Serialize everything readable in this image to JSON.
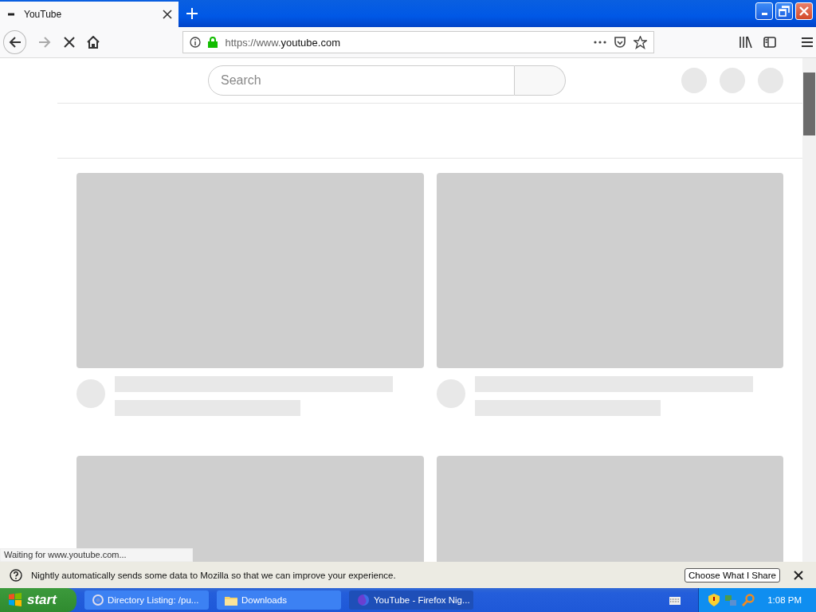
{
  "tabs": [
    {
      "title": "YouTube",
      "selected": true
    }
  ],
  "toolbar": {
    "loading": true,
    "url": {
      "scheme": "https://www.",
      "domain": "youtube.com"
    }
  },
  "page": {
    "search": {
      "placeholder": "Search"
    }
  },
  "status_text": "Waiting for www.youtube.com...",
  "notification": {
    "message": "Nightly automatically sends some data to Mozilla so that we can improve your experience.",
    "button": "Choose What I Share"
  },
  "taskbar": {
    "start": "start",
    "tasks": [
      {
        "label": "Directory Listing: /pu...",
        "kind": "chrome",
        "selected": false
      },
      {
        "label": "Downloads",
        "kind": "folder",
        "selected": false
      },
      {
        "label": "YouTube - Firefox Nig...",
        "kind": "firefox",
        "selected": true
      }
    ],
    "clock": "1:08 PM"
  }
}
